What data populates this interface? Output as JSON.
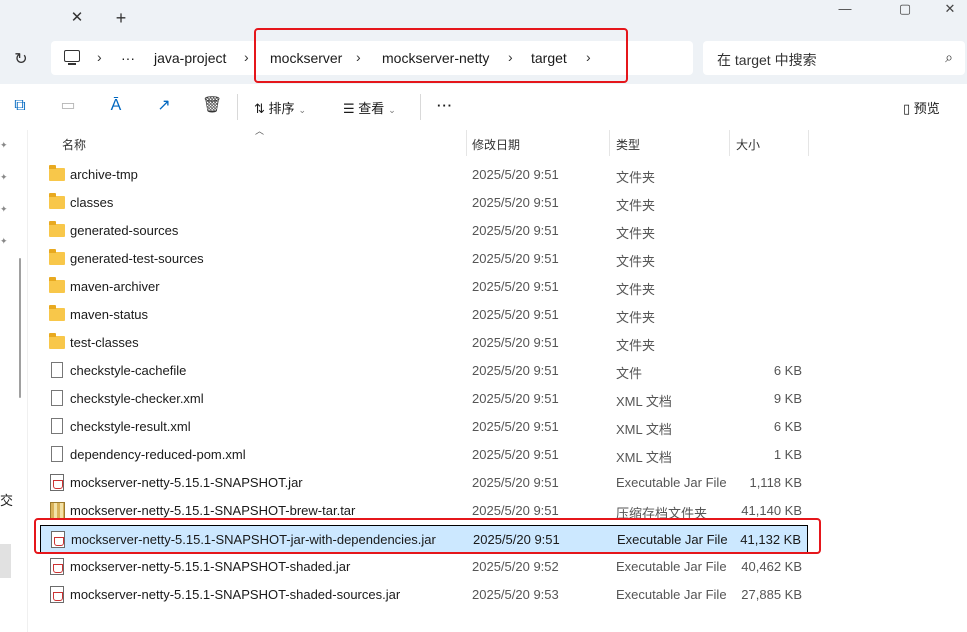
{
  "window": {
    "tab_close": "✕",
    "new_tab": "+",
    "minimize": "—",
    "maximize": "▢",
    "close": "✕"
  },
  "address": {
    "ellipsis": "···",
    "crumbs": [
      "java-project",
      "mockserver",
      "mockserver-netty",
      "target"
    ],
    "separator": "›"
  },
  "search": {
    "placeholder": "在 target 中搜索"
  },
  "toolbar": {
    "sort_label": "排序",
    "view_label": "查看",
    "more_label": "···",
    "preview_label": "预览"
  },
  "columns": {
    "name": "名称",
    "date": "修改日期",
    "type": "类型",
    "size": "大小"
  },
  "nav": {
    "truncated_text": "交"
  },
  "files": [
    {
      "name": "archive-tmp",
      "date": "2025/5/20 9:51",
      "type": "文件夹",
      "size": "",
      "icon": "folder-icon"
    },
    {
      "name": "classes",
      "date": "2025/5/20 9:51",
      "type": "文件夹",
      "size": "",
      "icon": "folder-icon"
    },
    {
      "name": "generated-sources",
      "date": "2025/5/20 9:51",
      "type": "文件夹",
      "size": "",
      "icon": "folder-icon"
    },
    {
      "name": "generated-test-sources",
      "date": "2025/5/20 9:51",
      "type": "文件夹",
      "size": "",
      "icon": "folder-icon"
    },
    {
      "name": "maven-archiver",
      "date": "2025/5/20 9:51",
      "type": "文件夹",
      "size": "",
      "icon": "folder-icon"
    },
    {
      "name": "maven-status",
      "date": "2025/5/20 9:51",
      "type": "文件夹",
      "size": "",
      "icon": "folder-icon"
    },
    {
      "name": "test-classes",
      "date": "2025/5/20 9:51",
      "type": "文件夹",
      "size": "",
      "icon": "folder-icon"
    },
    {
      "name": "checkstyle-cachefile",
      "date": "2025/5/20 9:51",
      "type": "文件",
      "size": "6 KB",
      "icon": "file-icon"
    },
    {
      "name": "checkstyle-checker.xml",
      "date": "2025/5/20 9:51",
      "type": "XML 文档",
      "size": "9 KB",
      "icon": "file-icon"
    },
    {
      "name": "checkstyle-result.xml",
      "date": "2025/5/20 9:51",
      "type": "XML 文档",
      "size": "6 KB",
      "icon": "file-icon"
    },
    {
      "name": "dependency-reduced-pom.xml",
      "date": "2025/5/20 9:51",
      "type": "XML 文档",
      "size": "1 KB",
      "icon": "file-icon"
    },
    {
      "name": "mockserver-netty-5.15.1-SNAPSHOT.jar",
      "date": "2025/5/20 9:51",
      "type": "Executable Jar File",
      "size": "1,118 KB",
      "icon": "jar-icon"
    },
    {
      "name": "mockserver-netty-5.15.1-SNAPSHOT-brew-tar.tar",
      "date": "2025/5/20 9:51",
      "type": "压缩存档文件夹",
      "size": "41,140 KB",
      "icon": "archive-icon"
    },
    {
      "name": "mockserver-netty-5.15.1-SNAPSHOT-jar-with-dependencies.jar",
      "date": "2025/5/20 9:51",
      "type": "Executable Jar File",
      "size": "41,132 KB",
      "icon": "jar-icon"
    },
    {
      "name": "mockserver-netty-5.15.1-SNAPSHOT-shaded.jar",
      "date": "2025/5/20 9:52",
      "type": "Executable Jar File",
      "size": "40,462 KB",
      "icon": "jar-icon"
    },
    {
      "name": "mockserver-netty-5.15.1-SNAPSHOT-shaded-sources.jar",
      "date": "2025/5/20 9:53",
      "type": "Executable Jar File",
      "size": "27,885 KB",
      "icon": "jar-icon"
    }
  ],
  "selected_index": 13,
  "colors": {
    "highlight": "#e5161b",
    "selection": "#cce8ff",
    "accent": "#0067c0"
  }
}
